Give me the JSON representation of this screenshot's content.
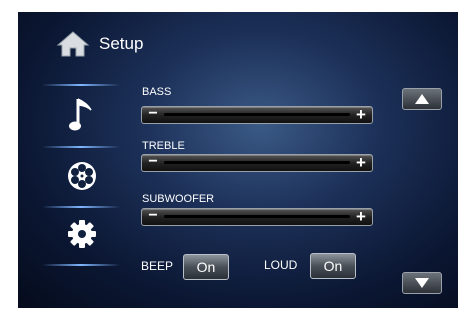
{
  "header": {
    "title": "Setup",
    "home_icon": "home-icon"
  },
  "sidebar": {
    "items": [
      {
        "icon": "music-note-icon"
      },
      {
        "icon": "film-reel-icon"
      },
      {
        "icon": "gear-icon"
      }
    ]
  },
  "controls": {
    "bass": {
      "label": "BASS"
    },
    "treble": {
      "label": "TREBLE"
    },
    "subwoofer": {
      "label": "SUBWOOFER"
    }
  },
  "options": {
    "beep": {
      "label": "BEEP",
      "value": "On"
    },
    "loud": {
      "label": "LOUD",
      "value": "On"
    }
  },
  "scroll": {
    "up_icon": "triangle-up-icon",
    "down_icon": "triangle-down-icon"
  }
}
